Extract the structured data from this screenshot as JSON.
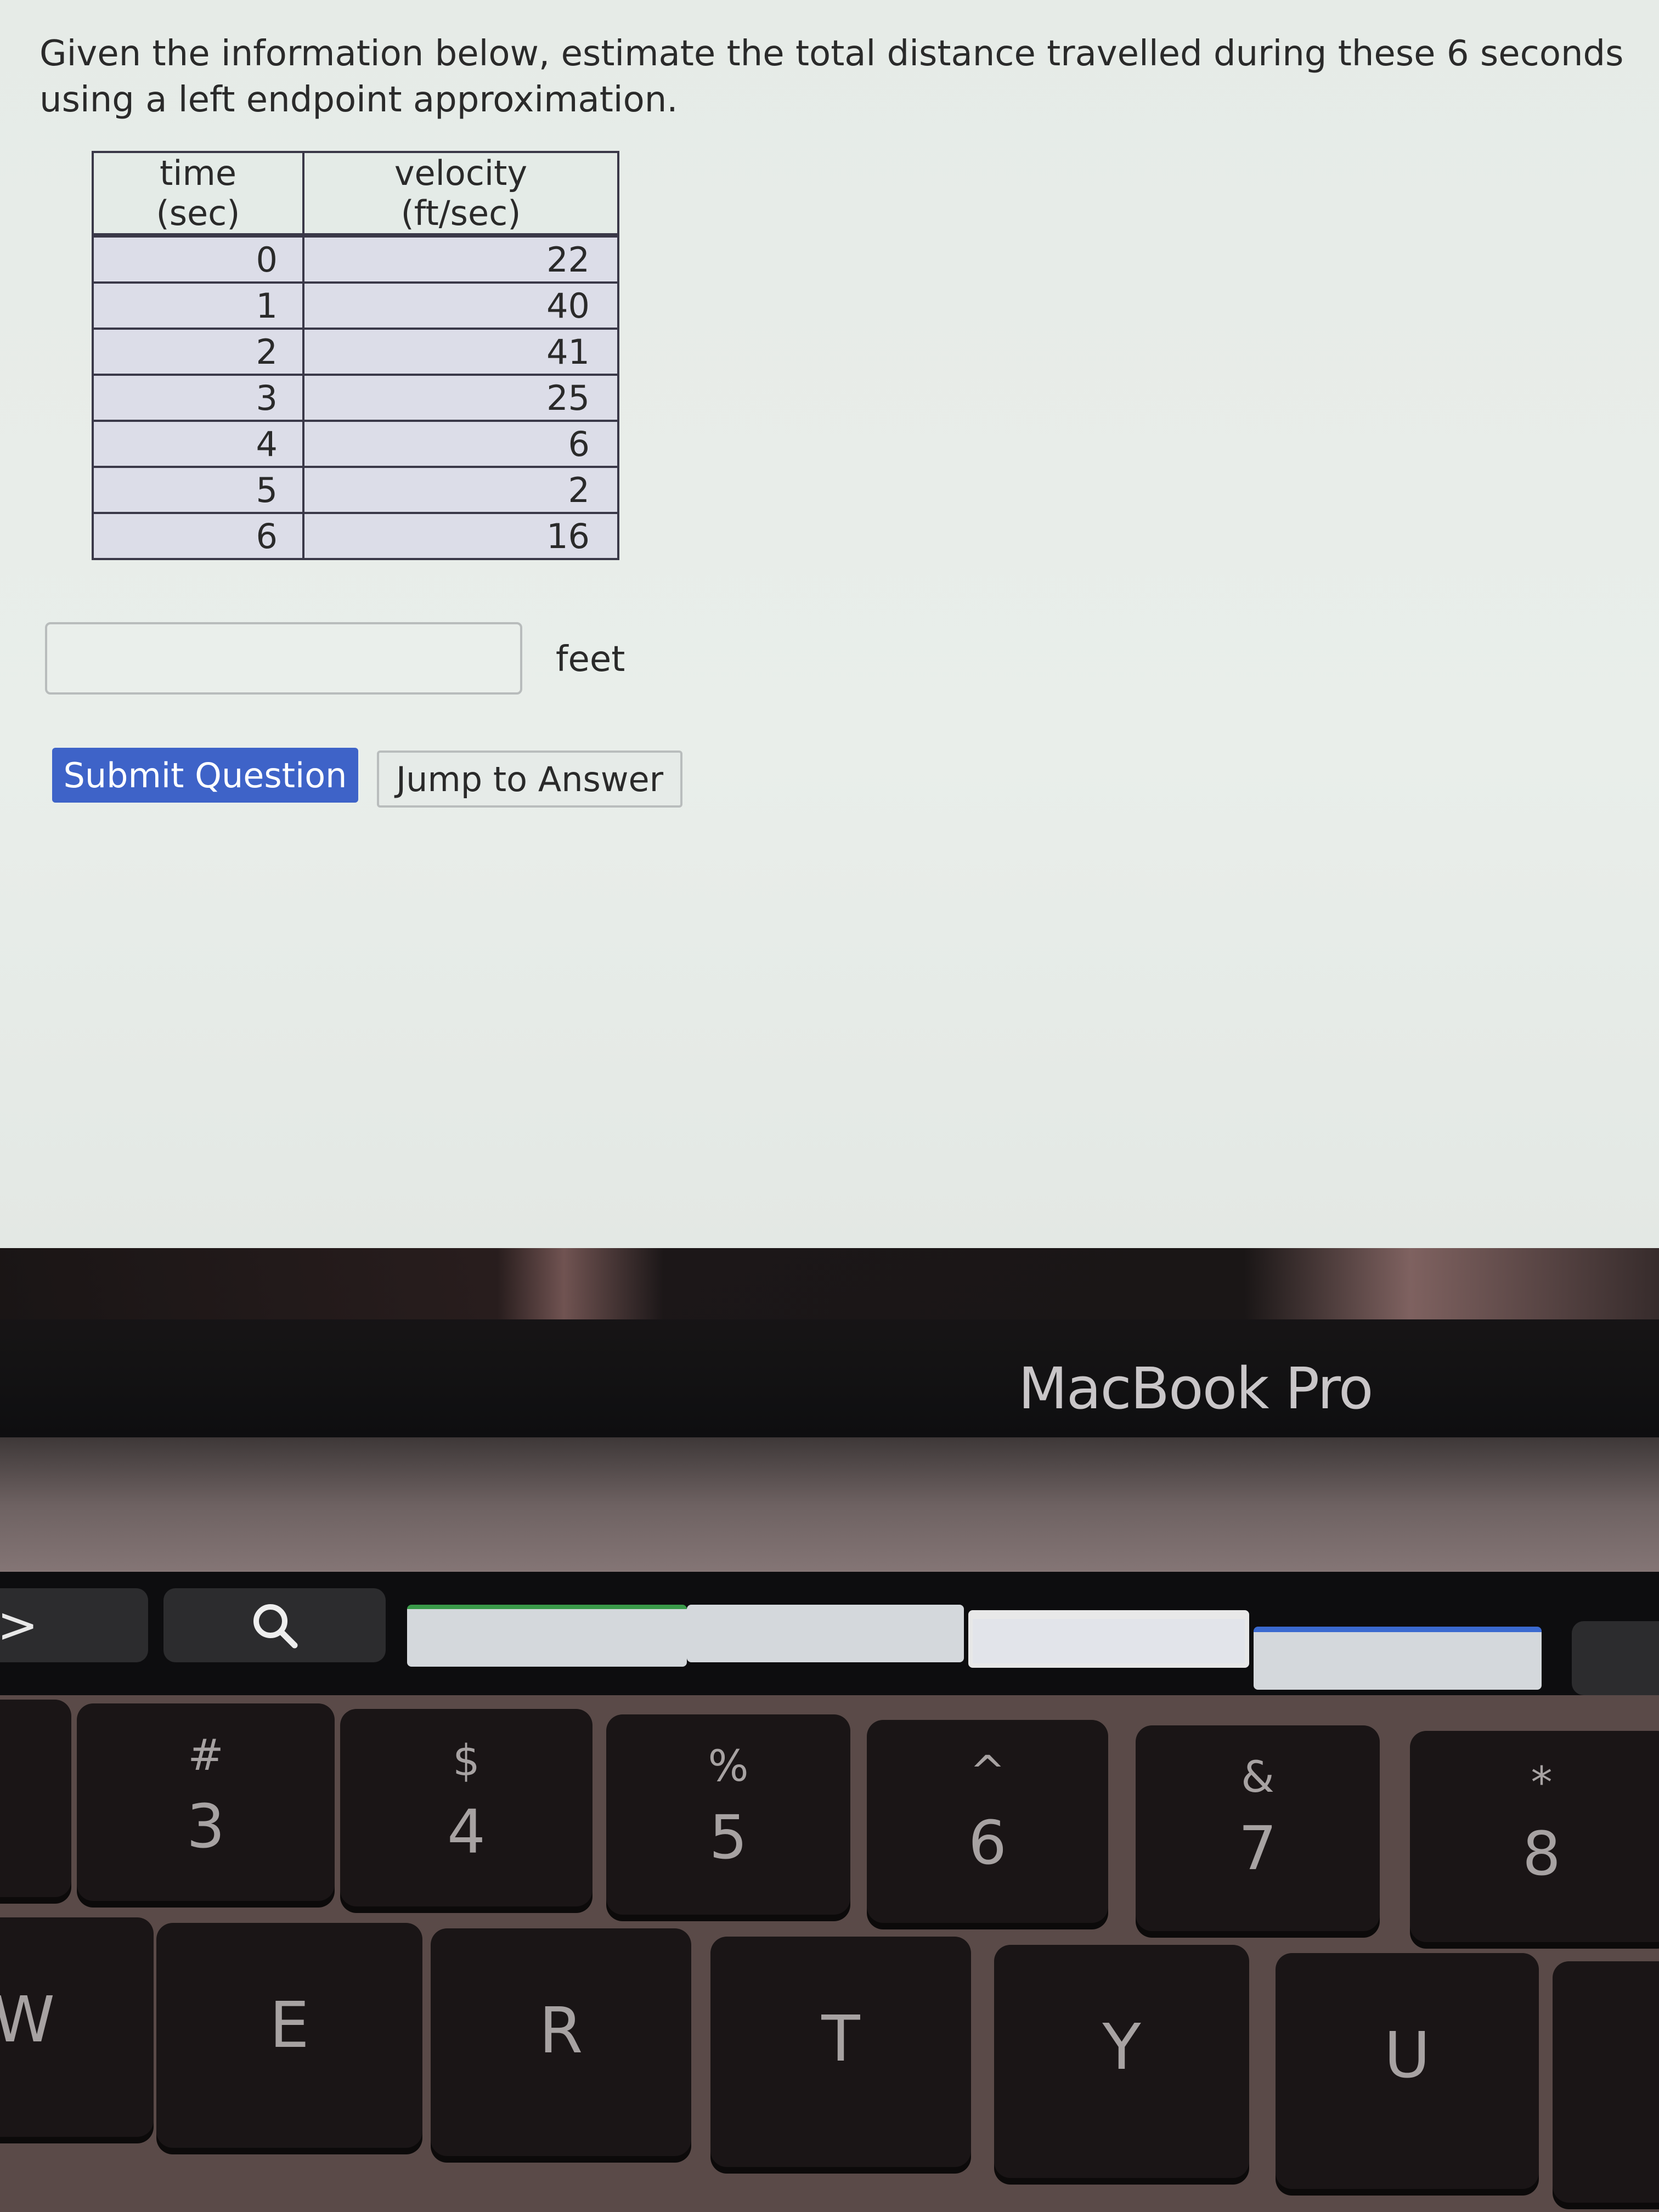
{
  "question": {
    "text": "Given the information below, estimate the total distance travelled during these 6 seconds using a left endpoint approximation."
  },
  "table": {
    "headers": [
      "time (sec)",
      "velocity (ft/sec)"
    ],
    "rows": [
      {
        "time": "0",
        "velocity": "22"
      },
      {
        "time": "1",
        "velocity": "40"
      },
      {
        "time": "2",
        "velocity": "41"
      },
      {
        "time": "3",
        "velocity": "25"
      },
      {
        "time": "4",
        "velocity": "6"
      },
      {
        "time": "5",
        "velocity": "2"
      },
      {
        "time": "6",
        "velocity": "16"
      }
    ]
  },
  "answer": {
    "value": "",
    "unit": "feet"
  },
  "buttons": {
    "submit": "Submit Question",
    "jump": "Jump to Answer"
  },
  "colors": {
    "submit_bg": "#3e63c8",
    "page_bg": "#e6ebe7",
    "table_row_bg": "#dcdde8"
  },
  "laptop": {
    "brand": "MacBook Pro"
  },
  "touchbar": {
    "expand_icon": "chevron-right-icon",
    "search_icon": "search-icon",
    "expand_glyph": ">"
  },
  "keyboard": {
    "number_row": [
      {
        "symbol": "#",
        "digit": "3"
      },
      {
        "symbol": "$",
        "digit": "4"
      },
      {
        "symbol": "%",
        "digit": "5"
      },
      {
        "symbol": "^",
        "digit": "6"
      },
      {
        "symbol": "&",
        "digit": "7"
      },
      {
        "symbol": "*",
        "digit": "8"
      }
    ],
    "letter_row": [
      "W",
      "E",
      "R",
      "T",
      "Y",
      "U"
    ]
  }
}
